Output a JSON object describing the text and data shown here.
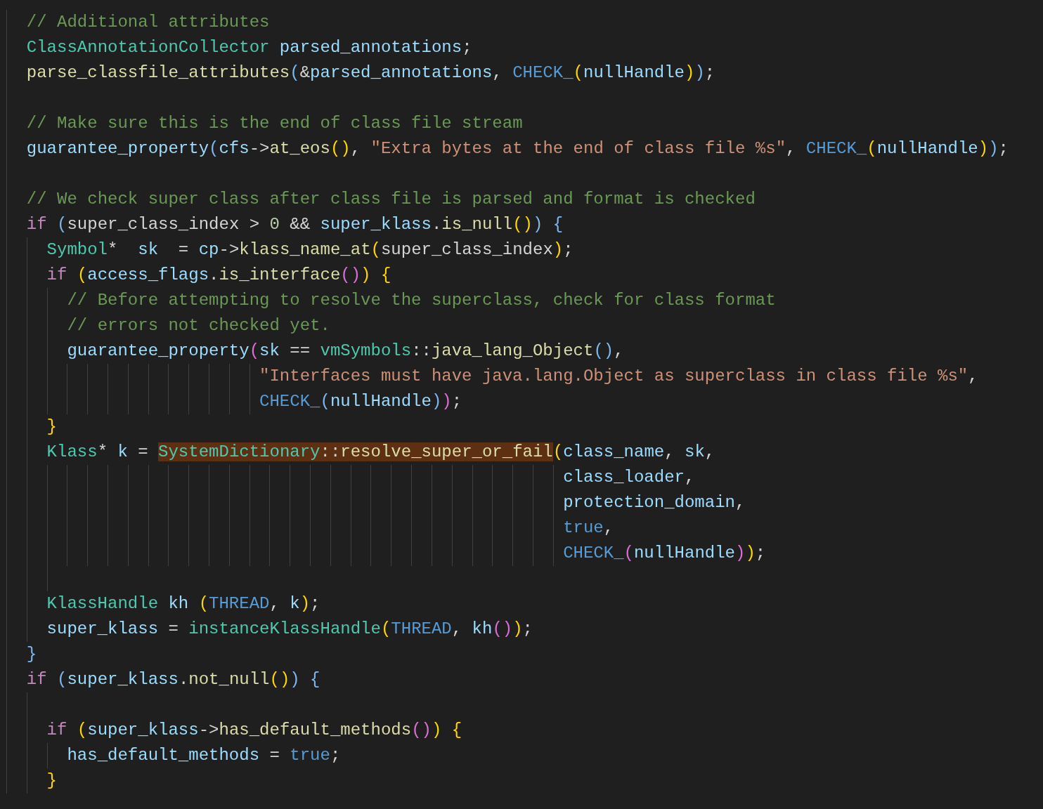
{
  "editor": {
    "lines": [
      {
        "kind": "code",
        "tokens": [
          {
            "kind": "comment",
            "text": "  // Additional attributes"
          }
        ]
      },
      {
        "kind": "code",
        "tokens": [
          {
            "kind": "type",
            "text": "  ClassAnnotationCollector"
          },
          {
            "kind": "variable",
            "text": " parsed_annotations"
          },
          {
            "kind": "plain",
            "text": ";"
          }
        ]
      },
      {
        "kind": "code",
        "tokens": [
          {
            "kind": "function",
            "text": "  parse_classfile_attributes"
          },
          {
            "kind": "bracket3",
            "text": "("
          },
          {
            "kind": "plain",
            "text": "&"
          },
          {
            "kind": "variable",
            "text": "parsed_annotations"
          },
          {
            "kind": "plain",
            "text": ", "
          },
          {
            "kind": "macro",
            "text": "CHECK_"
          },
          {
            "kind": "bracket1",
            "text": "("
          },
          {
            "kind": "variable",
            "text": "nullHandle"
          },
          {
            "kind": "bracket1",
            "text": ")"
          },
          {
            "kind": "bracket3",
            "text": ")"
          },
          {
            "kind": "plain",
            "text": ";"
          }
        ]
      },
      {
        "kind": "blank"
      },
      {
        "kind": "code",
        "tokens": [
          {
            "kind": "comment",
            "text": "  // Make sure this is the end of class file stream"
          }
        ]
      },
      {
        "kind": "code",
        "tokens": [
          {
            "kind": "variable",
            "text": "  guarantee_property"
          },
          {
            "kind": "bracket3",
            "text": "("
          },
          {
            "kind": "variable",
            "text": "cfs"
          },
          {
            "kind": "plain",
            "text": "->"
          },
          {
            "kind": "function",
            "text": "at_eos"
          },
          {
            "kind": "bracket1",
            "text": "()"
          },
          {
            "kind": "plain",
            "text": ", "
          },
          {
            "kind": "string",
            "text": "\"Extra bytes at the end of class file %s\""
          },
          {
            "kind": "plain",
            "text": ", "
          },
          {
            "kind": "macro",
            "text": "CHECK_"
          },
          {
            "kind": "bracket1",
            "text": "("
          },
          {
            "kind": "variable",
            "text": "nullHandle"
          },
          {
            "kind": "bracket1",
            "text": ")"
          },
          {
            "kind": "bracket3",
            "text": ")"
          },
          {
            "kind": "plain",
            "text": ";"
          }
        ]
      },
      {
        "kind": "blank"
      },
      {
        "kind": "code",
        "tokens": [
          {
            "kind": "comment",
            "text": "  // We check super class after class file is parsed and format is checked"
          }
        ]
      },
      {
        "kind": "code",
        "tokens": [
          {
            "kind": "keyword",
            "text": "  if "
          },
          {
            "kind": "bracket3",
            "text": "("
          },
          {
            "kind": "plain",
            "text": "super_class_index > "
          },
          {
            "kind": "number",
            "text": "0"
          },
          {
            "kind": "plain",
            "text": " && "
          },
          {
            "kind": "variable",
            "text": "super_klass"
          },
          {
            "kind": "plain",
            "text": "."
          },
          {
            "kind": "function",
            "text": "is_null"
          },
          {
            "kind": "bracket1",
            "text": "()"
          },
          {
            "kind": "bracket3",
            "text": ") {"
          }
        ]
      },
      {
        "kind": "code",
        "tokens": [
          {
            "kind": "type",
            "text": "    Symbol"
          },
          {
            "kind": "plain",
            "text": "*  "
          },
          {
            "kind": "variable",
            "text": "sk"
          },
          {
            "kind": "plain",
            "text": "  = "
          },
          {
            "kind": "variable",
            "text": "cp"
          },
          {
            "kind": "plain",
            "text": "->"
          },
          {
            "kind": "function",
            "text": "klass_name_at"
          },
          {
            "kind": "bracket1",
            "text": "("
          },
          {
            "kind": "plain",
            "text": "super_class_index"
          },
          {
            "kind": "bracket1",
            "text": ")"
          },
          {
            "kind": "plain",
            "text": ";"
          }
        ]
      },
      {
        "kind": "code",
        "tokens": [
          {
            "kind": "keyword",
            "text": "    if "
          },
          {
            "kind": "bracket1",
            "text": "("
          },
          {
            "kind": "variable",
            "text": "access_flags"
          },
          {
            "kind": "plain",
            "text": "."
          },
          {
            "kind": "function",
            "text": "is_interface"
          },
          {
            "kind": "bracket2",
            "text": "()"
          },
          {
            "kind": "bracket1",
            "text": ") {"
          }
        ]
      },
      {
        "kind": "code",
        "tokens": [
          {
            "kind": "comment",
            "text": "      // Before attempting to resolve the superclass, check for class format"
          }
        ]
      },
      {
        "kind": "code",
        "tokens": [
          {
            "kind": "comment",
            "text": "      // errors not checked yet."
          }
        ]
      },
      {
        "kind": "code",
        "tokens": [
          {
            "kind": "variable",
            "text": "      guarantee_property"
          },
          {
            "kind": "bracket2",
            "text": "("
          },
          {
            "kind": "variable",
            "text": "sk"
          },
          {
            "kind": "plain",
            "text": " == "
          },
          {
            "kind": "type",
            "text": "vmSymbols"
          },
          {
            "kind": "plain",
            "text": "::"
          },
          {
            "kind": "function",
            "text": "java_lang_Object"
          },
          {
            "kind": "bracket3",
            "text": "()"
          },
          {
            "kind": "plain",
            "text": ","
          }
        ]
      },
      {
        "kind": "code",
        "tokens": [
          {
            "kind": "string",
            "text": "                         \"Interfaces must have java.lang.Object as superclass in class file %s\""
          },
          {
            "kind": "plain",
            "text": ","
          }
        ]
      },
      {
        "kind": "code",
        "tokens": [
          {
            "kind": "macro",
            "text": "                         CHECK_"
          },
          {
            "kind": "bracket3",
            "text": "("
          },
          {
            "kind": "variable",
            "text": "nullHandle"
          },
          {
            "kind": "bracket3",
            "text": ")"
          },
          {
            "kind": "bracket2",
            "text": ")"
          },
          {
            "kind": "plain",
            "text": ";"
          }
        ]
      },
      {
        "kind": "code",
        "tokens": [
          {
            "kind": "bracket1",
            "text": "    }"
          }
        ]
      },
      {
        "kind": "code",
        "tokens": [
          {
            "kind": "type",
            "text": "    Klass"
          },
          {
            "kind": "plain",
            "text": "* "
          },
          {
            "kind": "variable",
            "text": "k"
          },
          {
            "kind": "plain",
            "text": " = "
          },
          {
            "kind": "type",
            "text": "SystemDictionary",
            "highlighted": true
          },
          {
            "kind": "plain",
            "text": "::",
            "highlighted": true
          },
          {
            "kind": "function",
            "text": "resolve_super_or_fail",
            "highlighted": true
          },
          {
            "kind": "bracket1",
            "text": "("
          },
          {
            "kind": "variable",
            "text": "class_name"
          },
          {
            "kind": "plain",
            "text": ", "
          },
          {
            "kind": "variable",
            "text": "sk"
          },
          {
            "kind": "plain",
            "text": ","
          }
        ]
      },
      {
        "kind": "code",
        "tokens": [
          {
            "kind": "variable",
            "text": "                                                       class_loader"
          },
          {
            "kind": "plain",
            "text": ","
          }
        ]
      },
      {
        "kind": "code",
        "tokens": [
          {
            "kind": "variable",
            "text": "                                                       protection_domain"
          },
          {
            "kind": "plain",
            "text": ","
          }
        ]
      },
      {
        "kind": "code",
        "tokens": [
          {
            "kind": "macro",
            "text": "                                                       true"
          },
          {
            "kind": "plain",
            "text": ","
          }
        ]
      },
      {
        "kind": "code",
        "tokens": [
          {
            "kind": "macro",
            "text": "                                                       CHECK_"
          },
          {
            "kind": "bracket2",
            "text": "("
          },
          {
            "kind": "variable",
            "text": "nullHandle"
          },
          {
            "kind": "bracket2",
            "text": ")"
          },
          {
            "kind": "bracket1",
            "text": ")"
          },
          {
            "kind": "plain",
            "text": ";"
          }
        ]
      },
      {
        "kind": "blank"
      },
      {
        "kind": "code",
        "tokens": [
          {
            "kind": "type",
            "text": "    KlassHandle"
          },
          {
            "kind": "variable",
            "text": " kh "
          },
          {
            "kind": "bracket1",
            "text": "("
          },
          {
            "kind": "macro",
            "text": "THREAD"
          },
          {
            "kind": "plain",
            "text": ", "
          },
          {
            "kind": "variable",
            "text": "k"
          },
          {
            "kind": "bracket1",
            "text": ")"
          },
          {
            "kind": "plain",
            "text": ";"
          }
        ]
      },
      {
        "kind": "code",
        "tokens": [
          {
            "kind": "variable",
            "text": "    super_klass"
          },
          {
            "kind": "plain",
            "text": " = "
          },
          {
            "kind": "type",
            "text": "instanceKlassHandle"
          },
          {
            "kind": "bracket1",
            "text": "("
          },
          {
            "kind": "macro",
            "text": "THREAD"
          },
          {
            "kind": "plain",
            "text": ", "
          },
          {
            "kind": "variable",
            "text": "kh"
          },
          {
            "kind": "bracket2",
            "text": "()"
          },
          {
            "kind": "bracket1",
            "text": ")"
          },
          {
            "kind": "plain",
            "text": ";"
          }
        ]
      },
      {
        "kind": "code",
        "tokens": [
          {
            "kind": "bracket3",
            "text": "  }"
          }
        ]
      },
      {
        "kind": "code",
        "tokens": [
          {
            "kind": "keyword",
            "text": "  if "
          },
          {
            "kind": "bracket3",
            "text": "("
          },
          {
            "kind": "variable",
            "text": "super_klass"
          },
          {
            "kind": "plain",
            "text": "."
          },
          {
            "kind": "function",
            "text": "not_null"
          },
          {
            "kind": "bracket1",
            "text": "()"
          },
          {
            "kind": "bracket3",
            "text": ") {"
          }
        ]
      },
      {
        "kind": "blank"
      },
      {
        "kind": "code",
        "tokens": [
          {
            "kind": "keyword",
            "text": "    if "
          },
          {
            "kind": "bracket1",
            "text": "("
          },
          {
            "kind": "variable",
            "text": "super_klass"
          },
          {
            "kind": "plain",
            "text": "->"
          },
          {
            "kind": "function",
            "text": "has_default_methods"
          },
          {
            "kind": "bracket2",
            "text": "()"
          },
          {
            "kind": "bracket1",
            "text": ") {"
          }
        ]
      },
      {
        "kind": "code",
        "tokens": [
          {
            "kind": "variable",
            "text": "      has_default_methods"
          },
          {
            "kind": "plain",
            "text": " = "
          },
          {
            "kind": "macro",
            "text": "true"
          },
          {
            "kind": "plain",
            "text": ";"
          }
        ]
      },
      {
        "kind": "code",
        "tokens": [
          {
            "kind": "bracket1",
            "text": "    }"
          }
        ]
      }
    ]
  }
}
